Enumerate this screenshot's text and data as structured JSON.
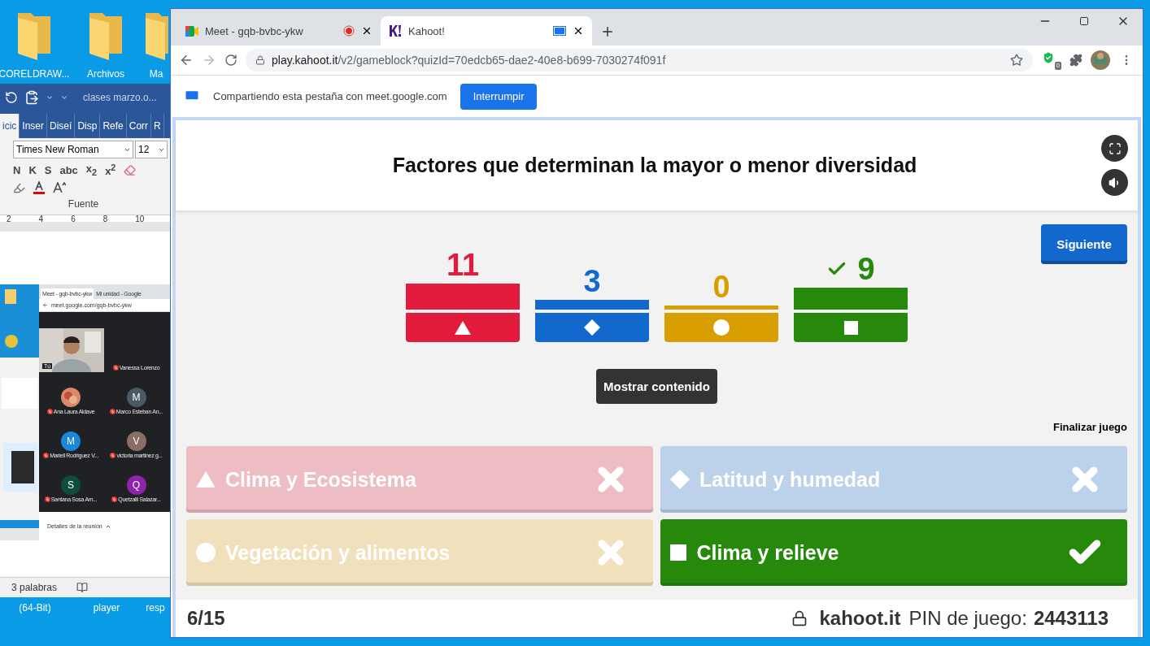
{
  "desktop": {
    "icons": [
      {
        "label": "CORELDRAW..."
      },
      {
        "label": "Archivos"
      },
      {
        "label": "Ma"
      }
    ],
    "bottom_icons": [
      {
        "label": "(64-Bit)"
      },
      {
        "label": "player"
      },
      {
        "label": "resp"
      }
    ]
  },
  "word": {
    "title": "clases marzo.o...",
    "tabs": [
      {
        "label": "icic",
        "selected": true
      },
      {
        "label": "Inser",
        "selected": false
      },
      {
        "label": "Diseí",
        "selected": false
      },
      {
        "label": "Disp",
        "selected": false
      },
      {
        "label": "Refe",
        "selected": false
      },
      {
        "label": "Corr",
        "selected": false
      },
      {
        "label": "R",
        "selected": false
      }
    ],
    "font": "Times New Roman",
    "size": "12",
    "format_buttons": [
      "N",
      "K",
      "S",
      "abc",
      "x$_{2}$",
      "x$^{2}$"
    ],
    "group_label": "Fuente",
    "ruler": [
      "2",
      "4",
      "6",
      "8",
      "10"
    ],
    "status": "3 palabras"
  },
  "meet_window": {
    "tabs": [
      {
        "label": "Meet - gqb-bvbc-ykw",
        "selected": true
      },
      {
        "label": "Mi unidad - Google",
        "selected": false
      }
    ],
    "url": "meet.google.com/gqb-bvbc-ykw",
    "participants": [
      {
        "name": "Tú",
        "kind": "video"
      },
      {
        "name": "Vanessa Lorenzo",
        "kind": "blank"
      },
      {
        "name": "Ana Laura Aldave"
      },
      {
        "name": "Marco Esteban An...",
        "kind": "initial",
        "initial": "M",
        "color": "#4a5a63"
      },
      {
        "name": "Mariell Rodriguez V...",
        "kind": "initial",
        "initial": "M",
        "color": "#1a88d8"
      },
      {
        "name": "victoria martinez g...",
        "kind": "initial",
        "initial": "V",
        "color": "#8a6e65"
      },
      {
        "name": "Santana Sosa Am...",
        "kind": "initial",
        "initial": "S",
        "color": "#0e4d3c"
      },
      {
        "name": "Quetzalli Salazar...",
        "kind": "initial",
        "initial": "Q",
        "color": "#8e24aa"
      }
    ],
    "details": "Detalles de la reunión"
  },
  "browser": {
    "tabs": [
      {
        "label": "Meet - gqb-bvbc-ykw",
        "selected": false,
        "kind": "recording"
      },
      {
        "label": "Kahoot!",
        "selected": true,
        "kind": "sharing"
      }
    ],
    "forward_disabled": true,
    "url_host": "play.kahoot.it",
    "url_path": "/v2/gameblock?quizId=70edcb65-dae2-40e8-b699-7030274f091f",
    "extension_badge": "0",
    "infobar": {
      "text": "Compartiendo esta pestaña con meet.google.com",
      "button": "Interrumpir"
    }
  },
  "kahoot": {
    "question": "Factores que determinan la mayor o menor diversidad",
    "next_button": "Siguiente",
    "results": [
      {
        "count": "11",
        "kind": "triangle",
        "correct": false
      },
      {
        "count": "3",
        "kind": "diamond",
        "correct": false
      },
      {
        "count": "0",
        "kind": "circle",
        "correct": false
      },
      {
        "count": "9",
        "kind": "square",
        "correct": true
      }
    ],
    "show_media_button": "Mostrar contenido",
    "end_game": "Finalizar juego",
    "answers": [
      {
        "kind": "triangle",
        "text": "Clima y Ecosistema",
        "correct": false
      },
      {
        "kind": "diamond",
        "text": "Latitud y humedad",
        "correct": false
      },
      {
        "kind": "circle",
        "text": "Vegetación y alimentos",
        "correct": false
      },
      {
        "kind": "square",
        "text": "Clima y relieve",
        "correct": true
      }
    ],
    "progress": "6/15",
    "site": "kahoot.it",
    "pin_label": "PIN de juego:",
    "pin": "2443113"
  }
}
